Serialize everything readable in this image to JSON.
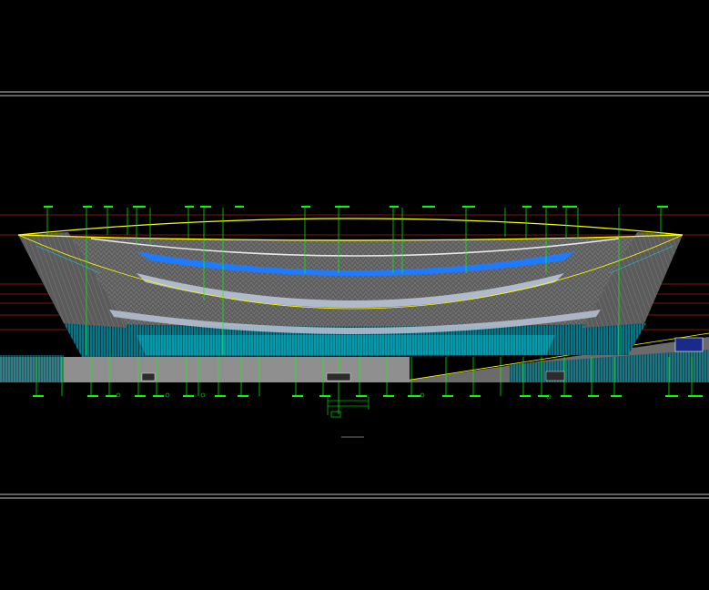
{
  "drawing": {
    "title_label": "",
    "background": "#000000",
    "colors": {
      "frame": "#ffffff",
      "level_line": "#ff2a2a",
      "leader": "#00ff00",
      "roof_outline": "#ffff00",
      "facade": "#6a6a6a",
      "blue_band": "#1e7bff",
      "cyan": "#00e5ff",
      "ground": "#8c8c8c",
      "silver": "#b9c3d6"
    }
  }
}
